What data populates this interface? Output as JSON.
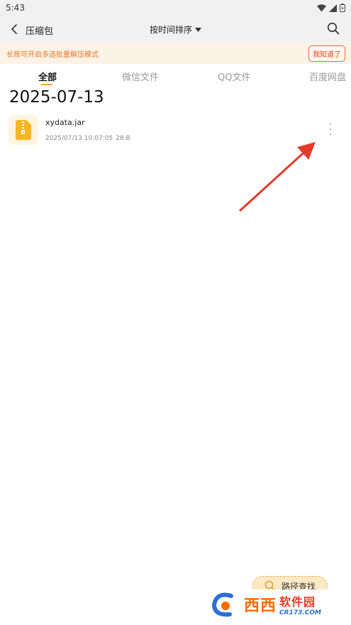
{
  "status_bar": {
    "time": "5:43"
  },
  "app_bar": {
    "title": "压缩包",
    "sort_label": "按时间排序"
  },
  "notice": {
    "text": "长按可开启多选批量解压模式",
    "button": "我知道了"
  },
  "tabs": [
    {
      "label": "全部",
      "active": true
    },
    {
      "label": "微信文件",
      "active": false
    },
    {
      "label": "QQ文件",
      "active": false
    },
    {
      "label": "百度网盘",
      "active": false
    }
  ],
  "groups": [
    {
      "date": "2025-07-13",
      "files": [
        {
          "name": "xydata.jar",
          "datetime": "2025/07/13 10:07:05",
          "size": "28 B"
        }
      ]
    }
  ],
  "path_search": {
    "label": "路径查找"
  },
  "watermark": {
    "brand": "西西",
    "title": "软件园",
    "url": "CR173.COM"
  },
  "colors": {
    "accent": "#f2a627",
    "notice_text": "#e2782b",
    "arrow": "#e53a2a"
  }
}
